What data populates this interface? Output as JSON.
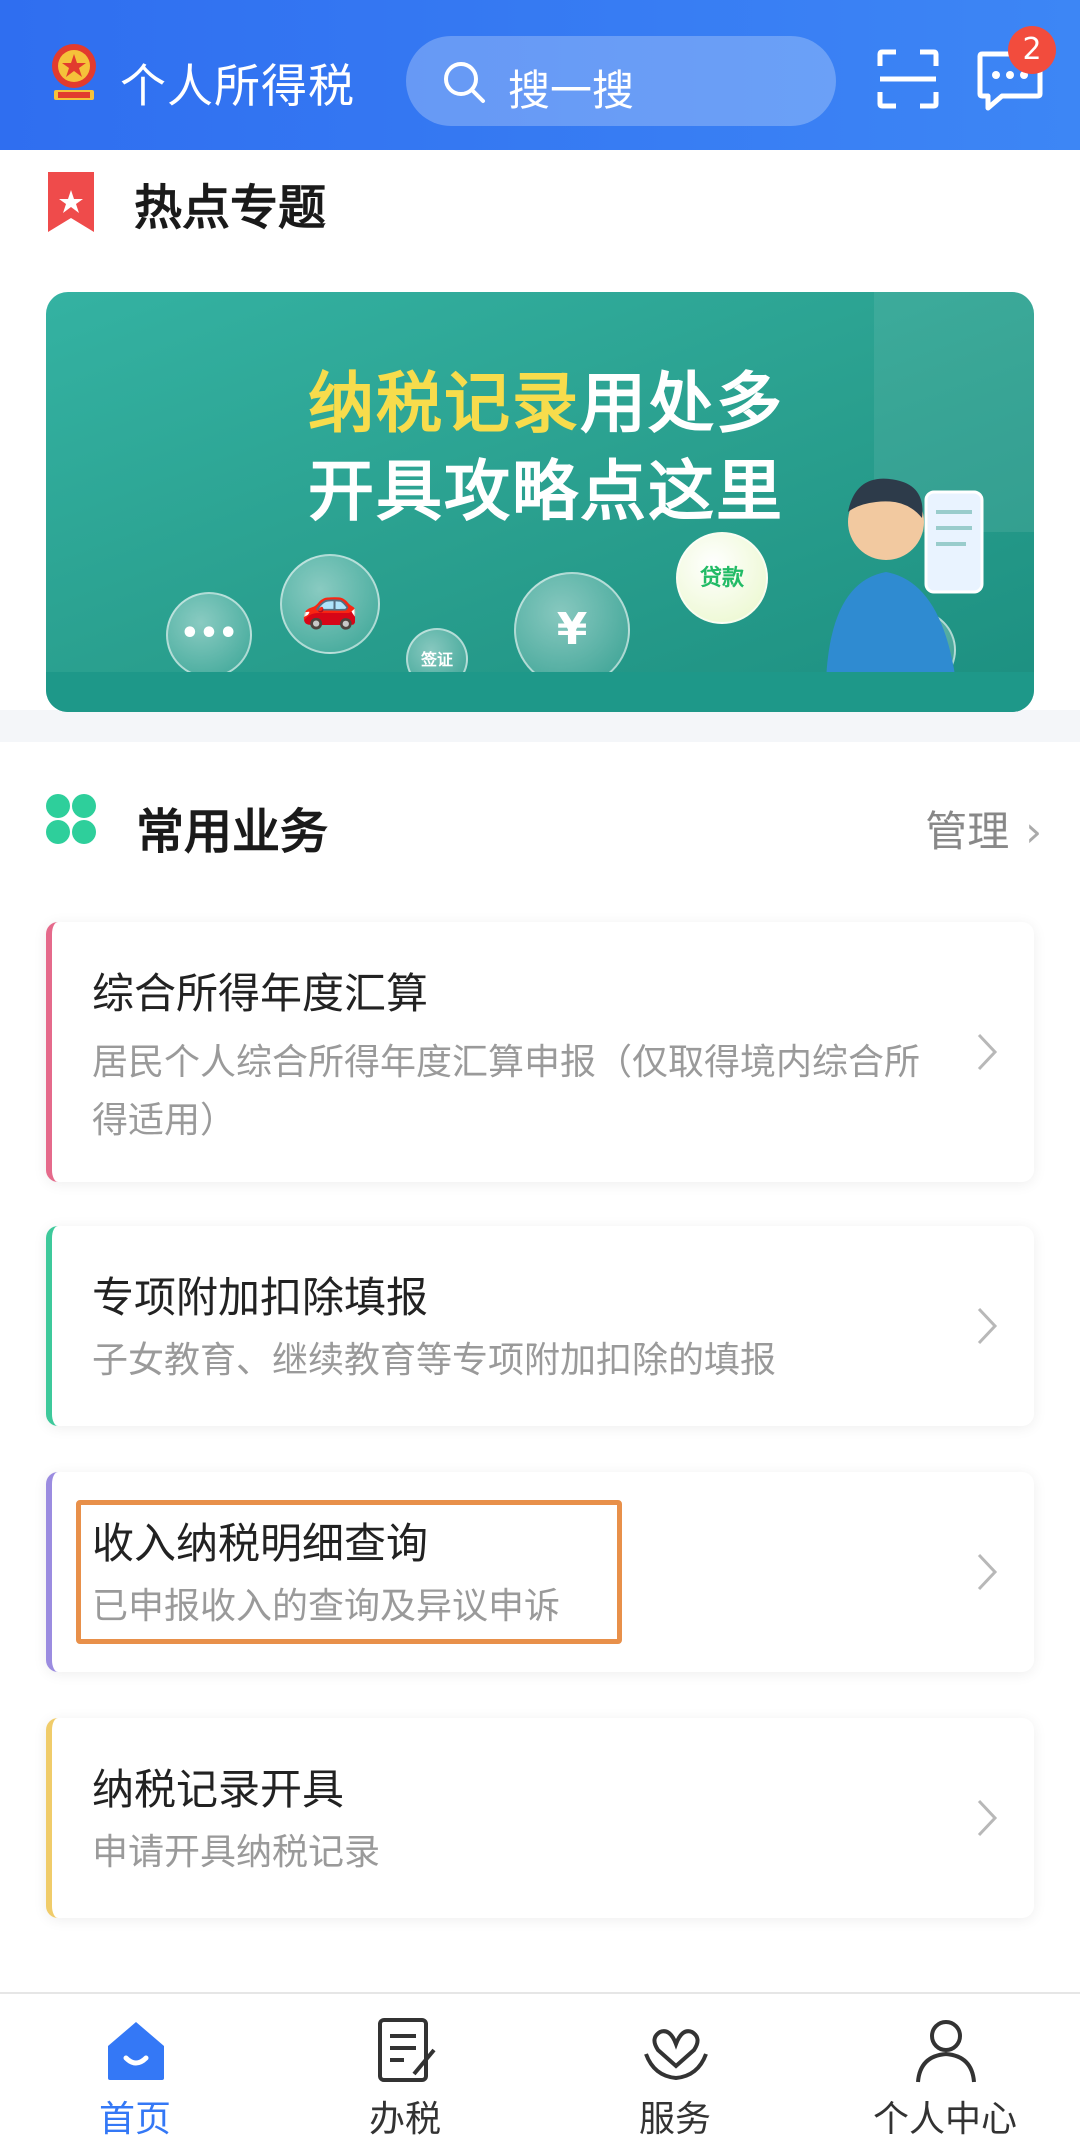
{
  "header": {
    "title": "个人所得税",
    "search_placeholder": "搜一搜",
    "message_badge": "2"
  },
  "hot_topics": {
    "title": "热点专题",
    "banner": {
      "line1_highlight": "纳税记录",
      "line1_rest": "用处多",
      "line2": "开具攻略点这里",
      "bubble_loan": "贷款",
      "bubble_visa": "签证",
      "bubble_home": "¥",
      "bubble_dots": "•••"
    }
  },
  "services": {
    "title": "常用业务",
    "manage_label": "管理",
    "items": [
      {
        "title": "综合所得年度汇算",
        "subtitle": "居民个人综合所得年度汇算申报（仅取得境内综合所得适用）",
        "accent": "#e56a8b"
      },
      {
        "title": "专项附加扣除填报",
        "subtitle": "子女教育、继续教育等专项附加扣除的填报",
        "accent": "#3ec99b"
      },
      {
        "title": "收入纳税明细查询",
        "subtitle": "已申报收入的查询及异议申诉",
        "accent": "#9b8ce0"
      },
      {
        "title": "纳税记录开具",
        "subtitle": "申请开具纳税记录",
        "accent": "#f0cc6a"
      }
    ]
  },
  "tabbar": {
    "tabs": [
      {
        "label": "首页",
        "icon": "home-icon",
        "active": true
      },
      {
        "label": "办税",
        "icon": "tax-form-icon",
        "active": false
      },
      {
        "label": "服务",
        "icon": "service-heart-icon",
        "active": false
      },
      {
        "label": "个人中心",
        "icon": "profile-icon",
        "active": false
      }
    ]
  },
  "colors": {
    "header_blue": "#2f6ef0",
    "active_tab": "#3478f6",
    "highlight_orange": "#e8904a",
    "badge_red": "#f24c3d"
  }
}
